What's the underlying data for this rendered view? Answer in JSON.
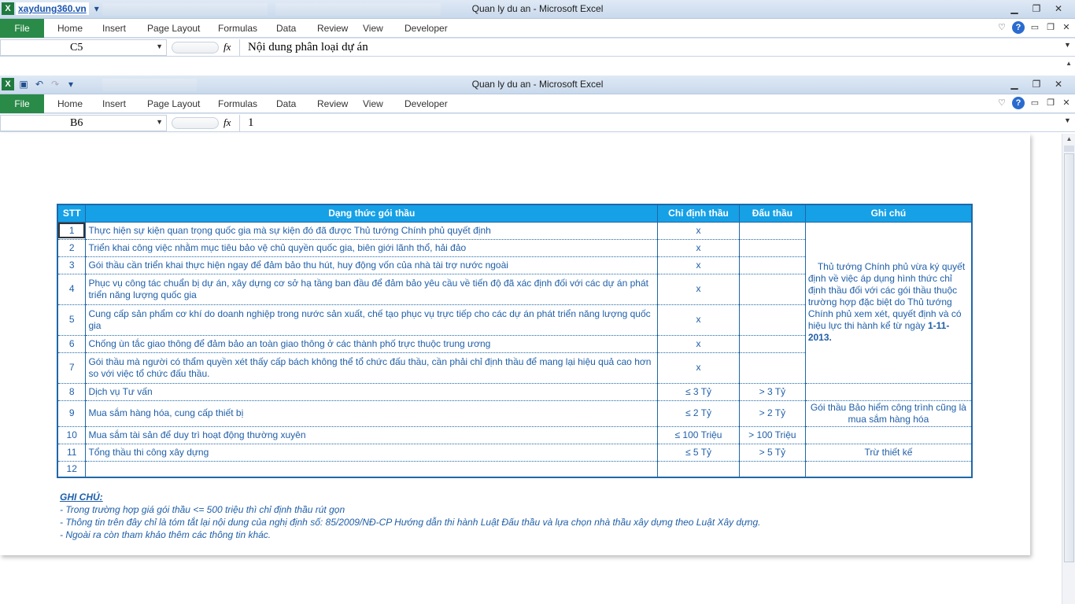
{
  "window1": {
    "brand": "xaydung360.vn",
    "title": "Quan ly du an  -  Microsoft Excel",
    "file_tab": "File",
    "tabs": [
      "Home",
      "Insert",
      "Page Layout",
      "Formulas",
      "Data",
      "Review",
      "View",
      "Developer"
    ],
    "name_box": "C5",
    "fx": "fx",
    "formula": "Nội dung phân loại dự án"
  },
  "window2": {
    "title": "Quan ly du an  -  Microsoft Excel",
    "file_tab": "File",
    "tabs": [
      "Home",
      "Insert",
      "Page Layout",
      "Formulas",
      "Data",
      "Review",
      "View",
      "Developer"
    ],
    "name_box": "B6",
    "fx": "fx",
    "formula": "1"
  },
  "table": {
    "headers": {
      "stt": "STT",
      "form": "Dạng thức gói thầu",
      "chidinh": "Chỉ định thầu",
      "dauthau": "Đấu thầu",
      "ghichu": "Ghi chú"
    },
    "rows": [
      {
        "stt": "1",
        "form": "Thực hiện sự kiện quan trọng quốc gia mà sự kiện đó đã được Thủ tướng Chính phủ quyết định",
        "chidinh": "x",
        "dauthau": ""
      },
      {
        "stt": "2",
        "form": "Triển khai công việc nhằm mục tiêu bảo vệ chủ quyền quốc gia, biên giới lãnh thổ, hải đảo",
        "chidinh": "x",
        "dauthau": ""
      },
      {
        "stt": "3",
        "form": "Gói thầu cần triển khai thực hiện ngay để đảm bảo thu hút, huy động vốn của nhà tài trợ nước ngoài",
        "chidinh": "x",
        "dauthau": ""
      },
      {
        "stt": "4",
        "form": "Phục vụ công tác chuẩn bị dự án, xây dựng cơ sở hạ tầng ban đầu để đảm bảo yêu cầu về tiến độ đã xác định đối với các dự án phát triển năng lượng quốc gia",
        "chidinh": "x",
        "dauthau": ""
      },
      {
        "stt": "5",
        "form": "Cung cấp sản phẩm cơ khí do doanh nghiệp trong nước sản xuất, chế tạo phục vụ trực tiếp cho các dự án phát triển năng lượng quốc gia",
        "chidinh": "x",
        "dauthau": ""
      },
      {
        "stt": "6",
        "form": "Chống ùn tắc giao thông để đảm bảo an toàn giao thông ở các thành phố trực thuộc trung ương",
        "chidinh": "x",
        "dauthau": ""
      },
      {
        "stt": "7",
        "form": "Gói thầu mà người có thẩm quyền xét thấy cấp bách không thể tổ chức đấu thầu, cần phải chỉ định thầu để mang lại hiệu quả cao hơn so với việc tổ chức đấu thầu.",
        "chidinh": "x",
        "dauthau": ""
      },
      {
        "stt": "8",
        "form": "Dịch vụ Tư vấn",
        "chidinh": "≤ 3 Tỷ",
        "dauthau": "> 3 Tỷ",
        "note": ""
      },
      {
        "stt": "9",
        "form": "Mua sắm hàng hóa, cung cấp thiết bị",
        "chidinh": "≤ 2 Tỷ",
        "dauthau": "> 2 Tỷ",
        "note": "Gói thầu Bảo hiểm công trình cũng là mua sắm hàng hóa"
      },
      {
        "stt": "10",
        "form": "Mua sắm tài sản để duy trì hoạt  động thường xuyên",
        "chidinh": "≤ 100 Triệu",
        "dauthau": "> 100 Triệu",
        "note": ""
      },
      {
        "stt": "11",
        "form": "Tổng thầu thi công xây dựng",
        "chidinh": "≤ 5 Tỷ",
        "dauthau": "> 5 Tỷ",
        "note": "Trừ thiết kế"
      },
      {
        "stt": "12",
        "form": "",
        "chidinh": "",
        "dauthau": "",
        "note": ""
      }
    ],
    "merged_note_text": "Thủ tướng Chính phủ vừa ký quyết định về việc áp dụng hình thức chỉ định thầu đối với các gói thầu thuộc trường hợp đặc biệt do Thủ tướng Chính phủ xem xét, quyết định và có hiệu lực thi hành kể từ ngày",
    "merged_note_date": "1-11-2013",
    "merged_note_end": "."
  },
  "notes": {
    "title": "GHI CHÚ:",
    "lines": [
      "- Trong trường hợp giá gói thầu <= 500 triệu thì chỉ định thầu rút gọn",
      "- Thông tin trên đây chỉ là tóm tắt lại nội dung của nghị định số: 85/2009/NĐ-CP Hướng dẫn thi hành Luật Đấu thầu và lựa chọn nhà thầu xây dựng theo Luật Xây dựng.",
      "- Ngoài ra còn tham khảo thêm các thông tin khác."
    ]
  }
}
